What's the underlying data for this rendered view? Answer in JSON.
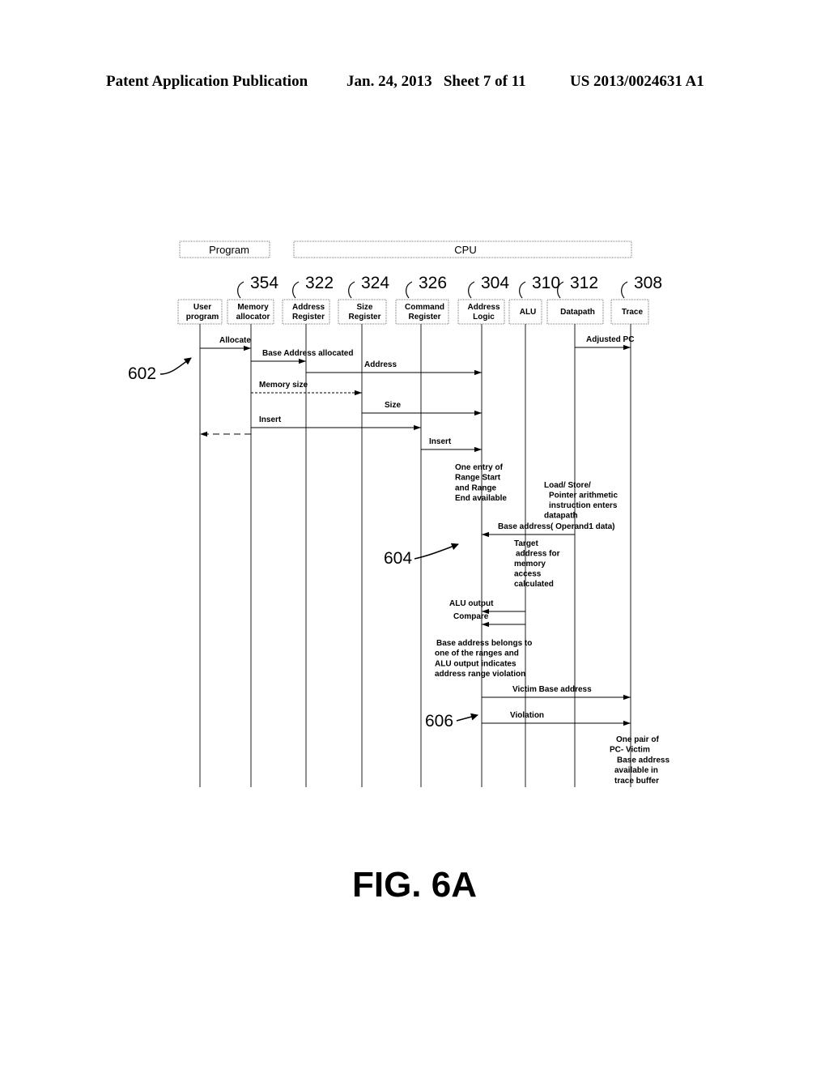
{
  "header": {
    "publication": "Patent Application Publication",
    "date_sheet": "Jan. 24, 2013   Sheet 7 of 11",
    "patent_number": "US 2013/0024631 A1"
  },
  "groups": [
    {
      "label": "Program"
    },
    {
      "label": "CPU"
    }
  ],
  "participants": [
    {
      "ref": "",
      "line1": "User",
      "line2": "program"
    },
    {
      "ref": "354",
      "line1": "Memory",
      "line2": "allocator"
    },
    {
      "ref": "322",
      "line1": "Address",
      "line2": "Register"
    },
    {
      "ref": "324",
      "line1": "Size",
      "line2": "Register"
    },
    {
      "ref": "326",
      "line1": "Command",
      "line2": "Register"
    },
    {
      "ref": "304",
      "line1": "Address",
      "line2": "Logic"
    },
    {
      "ref": "310",
      "line1": "ALU",
      "line2": ""
    },
    {
      "ref": "312",
      "line1": "Datapath",
      "line2": ""
    },
    {
      "ref": "308",
      "line1": "Trace",
      "line2": ""
    }
  ],
  "messages": [
    {
      "label": "Allocate",
      "from": 0,
      "to": 1,
      "style": "solid"
    },
    {
      "label": "Adjusted PC",
      "from": 7,
      "to": 8,
      "style": "solid"
    },
    {
      "label": "Base Address allocated",
      "from": 1,
      "to": 2,
      "style": "solid"
    },
    {
      "label": "Address",
      "from": 2,
      "to": 5,
      "style": "solid"
    },
    {
      "label": "Memory size",
      "from": 1,
      "to": 3,
      "style": "dashed"
    },
    {
      "label": "Size",
      "from": 3,
      "to": 5,
      "style": "solid"
    },
    {
      "label": "Insert",
      "from": 1,
      "to": 4,
      "style": "solid"
    },
    {
      "label": "",
      "from": 1,
      "to": 0,
      "style": "dashed"
    },
    {
      "label": "Insert",
      "from": 4,
      "to": 5,
      "style": "solid"
    },
    {
      "label": "Base address( Operand1 data)",
      "from": 7,
      "to": 5,
      "style": "solid"
    },
    {
      "label": "ALU output",
      "from": 6,
      "to": 5,
      "style": "solid"
    },
    {
      "label": "Compare",
      "from": 6,
      "to": 5,
      "style": "solid"
    },
    {
      "label": "Victim Base address",
      "from": 5,
      "to": 8,
      "style": "solid"
    },
    {
      "label": "Violation",
      "from": 5,
      "to": 8,
      "style": "solid"
    }
  ],
  "notes": [
    {
      "lines": [
        "One entry of",
        "Range Start",
        "and Range",
        "End available"
      ]
    },
    {
      "lines": [
        "Load/ Store/",
        "Pointer arithmetic",
        "instruction enters",
        "datapath"
      ]
    },
    {
      "lines": [
        "Target",
        "address for",
        "memory",
        "access",
        "calculated"
      ]
    },
    {
      "lines": [
        "Base address belongs to",
        "one of the ranges  and",
        "ALU output indicates",
        "address range violation"
      ]
    },
    {
      "lines": [
        "One pair of",
        "PC- Victim",
        "Base address",
        "available in",
        "trace buffer"
      ]
    }
  ],
  "callouts": [
    {
      "label": "602"
    },
    {
      "label": "604"
    },
    {
      "label": "606"
    }
  ],
  "figure_label": "FIG. 6A"
}
